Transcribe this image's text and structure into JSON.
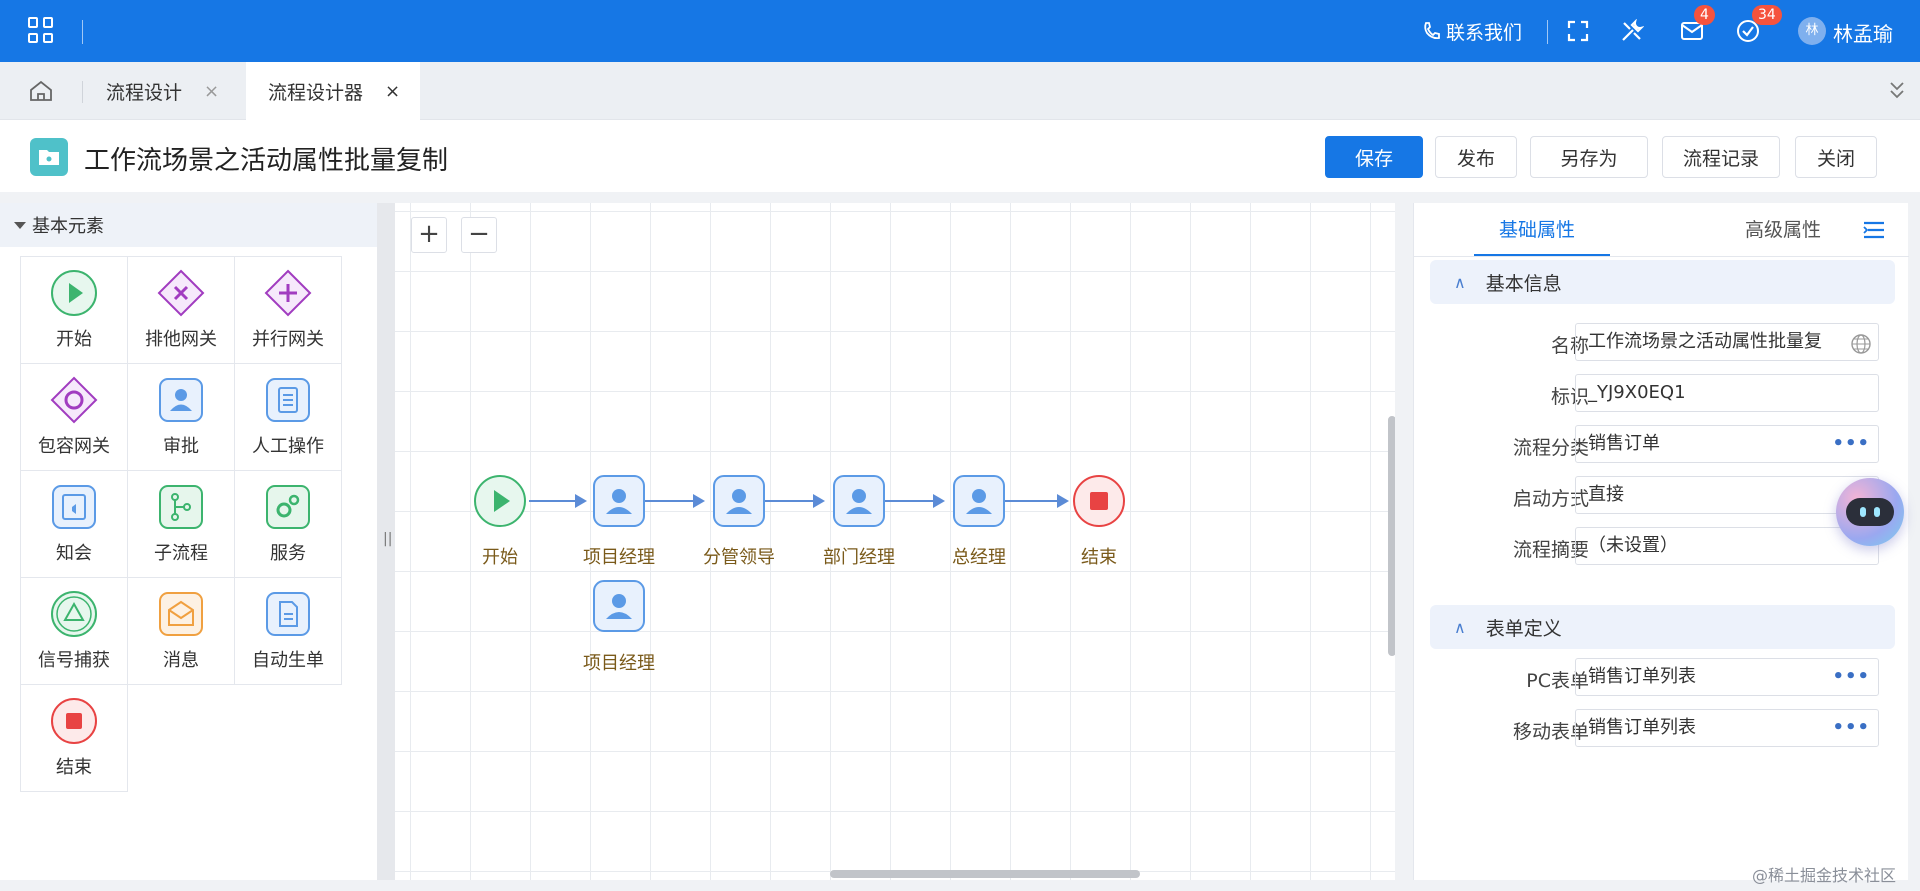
{
  "topbar": {
    "contact": "联系我们",
    "mail_badge": "4",
    "task_badge": "34",
    "avatar_initial": "林",
    "user_name": "林孟瑜"
  },
  "tabs": [
    {
      "label": "流程设计",
      "close": "×"
    },
    {
      "label": "流程设计器",
      "close": "×"
    }
  ],
  "header": {
    "title": "工作流场景之活动属性批量复制",
    "buttons": {
      "save": "保存",
      "publish": "发布",
      "save_as": "另存为",
      "history": "流程记录",
      "close": "关闭"
    }
  },
  "palette": {
    "section": "基本元素",
    "items": [
      {
        "label": "开始",
        "icon": "start-icon"
      },
      {
        "label": "排他网关",
        "icon": "exclusive-gateway-icon"
      },
      {
        "label": "并行网关",
        "icon": "parallel-gateway-icon"
      },
      {
        "label": "包容网关",
        "icon": "inclusive-gateway-icon"
      },
      {
        "label": "审批",
        "icon": "approval-icon"
      },
      {
        "label": "人工操作",
        "icon": "manual-task-icon"
      },
      {
        "label": "知会",
        "icon": "notify-icon"
      },
      {
        "label": "子流程",
        "icon": "subprocess-icon"
      },
      {
        "label": "服务",
        "icon": "service-icon"
      },
      {
        "label": "信号捕获",
        "icon": "signal-catch-icon"
      },
      {
        "label": "消息",
        "icon": "message-icon"
      },
      {
        "label": "自动生单",
        "icon": "auto-order-icon"
      },
      {
        "label": "结束",
        "icon": "end-icon"
      }
    ]
  },
  "canvas": {
    "zoom_in": "+",
    "zoom_out": "−",
    "nodes": [
      {
        "label": "开始",
        "type": "start"
      },
      {
        "label": "项目经理",
        "type": "user"
      },
      {
        "label": "分管领导",
        "type": "user"
      },
      {
        "label": "部门经理",
        "type": "user"
      },
      {
        "label": "总经理",
        "type": "user"
      },
      {
        "label": "结束",
        "type": "end"
      },
      {
        "label": "项目经理",
        "type": "user"
      }
    ]
  },
  "right_panel": {
    "tabs": {
      "basic": "基础属性",
      "advanced": "高级属性"
    },
    "sections": {
      "basic_info": "基本信息",
      "form_def": "表单定义"
    },
    "fields": {
      "name": {
        "label": "名称",
        "value": "工作流场景之活动属性批量复"
      },
      "key": {
        "label": "标识",
        "value": "_YJ9X0EQ1"
      },
      "category": {
        "label": "流程分类",
        "value": "销售订单"
      },
      "start_mode": {
        "label": "启动方式",
        "value": "直接"
      },
      "summary": {
        "label": "流程摘要",
        "value": "（未设置）"
      },
      "pc_form": {
        "label": "PC表单",
        "value": "销售订单列表"
      },
      "mobile_form": {
        "label": "移动表单",
        "value": "销售订单列表"
      }
    },
    "more": "•••"
  },
  "watermark": "@稀土掘金技术社区",
  "colors": {
    "primary": "#1677e5",
    "start": "#3cb46e",
    "end": "#e84343",
    "gateway": "#a13cc0"
  }
}
